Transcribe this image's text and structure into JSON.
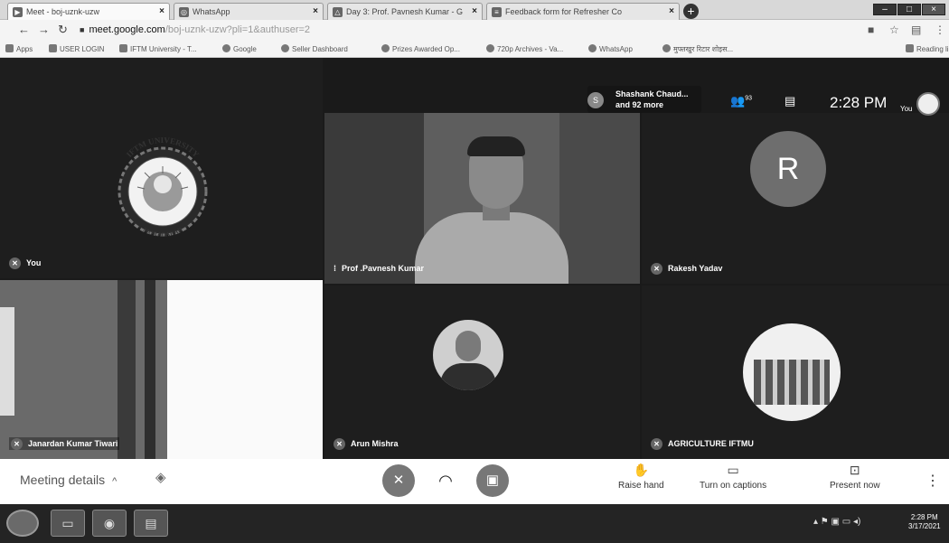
{
  "browser": {
    "tabs": [
      {
        "title": "Meet - boj-uznk-uzw",
        "icon": "meet-icon"
      },
      {
        "title": "WhatsApp",
        "icon": "whatsapp-icon"
      },
      {
        "title": "Day 3: Prof. Pavnesh Kumar - G",
        "icon": "drive-icon"
      },
      {
        "title": "Feedback form for Refresher Co",
        "icon": "forms-icon"
      }
    ],
    "url_host": "meet.google.com",
    "url_path": "/boj-uznk-uzw?pli=1&authuser=2",
    "bookmarks": [
      {
        "label": "Apps",
        "icon": "apps-icon"
      },
      {
        "label": "USER LOGIN",
        "icon": "bookmark-icon"
      },
      {
        "label": "IFTM University - T...",
        "icon": "bookmark-icon"
      },
      {
        "label": "Google",
        "icon": "google-icon"
      },
      {
        "label": "Seller Dashboard",
        "icon": "bookmark-icon"
      },
      {
        "label": "Prizes Awarded Op...",
        "icon": "bookmark-icon"
      },
      {
        "label": "720p Archives - Va...",
        "icon": "bookmark-icon"
      },
      {
        "label": "WhatsApp",
        "icon": "whatsapp-icon"
      },
      {
        "label": "मुफ्तखुर रिटार शोइस...",
        "icon": "bookmark-icon"
      },
      {
        "label": "Reading list",
        "icon": "reading-list-icon"
      }
    ]
  },
  "meet": {
    "participants_line1": "Shashank Chaud...",
    "participants_line2": "and 92 more",
    "participants_avatar_letter": "S",
    "participant_count_badge": "93",
    "time": "2:28 PM",
    "self_label": "You",
    "logo_text_top": "IFTM UNIVERSITY",
    "logo_text_bottom": "MORADABAD",
    "tiles": [
      {
        "name": "You"
      },
      {
        "name": "Prof .Pavnesh Kumar"
      },
      {
        "name": "Rakesh Yadav",
        "avatar_letter": "R"
      },
      {
        "name": "Janardan Kumar Tiwari"
      },
      {
        "name": "Arun Mishra"
      },
      {
        "name": "AGRICULTURE IFTMU"
      }
    ],
    "bottom": {
      "meeting_details": "Meeting details",
      "raise_hand": "Raise hand",
      "captions": "Turn on captions",
      "present": "Present now"
    }
  },
  "taskbar": {
    "time": "2:28 PM",
    "date": "3/17/2021"
  }
}
